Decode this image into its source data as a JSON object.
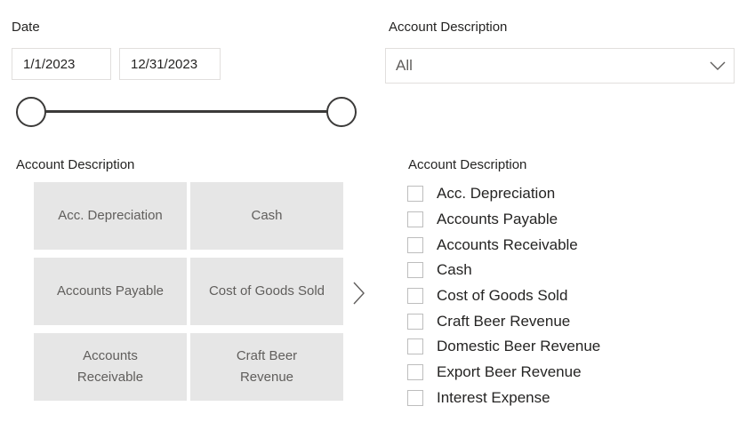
{
  "date_slicer": {
    "label": "Date",
    "start": "1/1/2023",
    "end": "12/31/2023"
  },
  "dropdown_slicer": {
    "label": "Account Description",
    "selected": "All",
    "chevron_icon": "chevron-down-icon"
  },
  "tile_slicer": {
    "label": "Account Description",
    "tiles": [
      "Acc. Depreciation",
      "Cash",
      "Accounts Payable",
      "Cost of Goods Sold",
      "Accounts Receivable",
      "Craft Beer Revenue"
    ],
    "next_icon": "chevron-right-icon"
  },
  "list_slicer": {
    "label": "Account Description",
    "items": [
      {
        "label": "Acc. Depreciation",
        "checked": false
      },
      {
        "label": "Accounts Payable",
        "checked": false
      },
      {
        "label": "Accounts Receivable",
        "checked": false
      },
      {
        "label": "Cash",
        "checked": false
      },
      {
        "label": "Cost of Goods Sold",
        "checked": false
      },
      {
        "label": "Craft Beer Revenue",
        "checked": false
      },
      {
        "label": "Domestic Beer Revenue",
        "checked": false
      },
      {
        "label": "Export Beer Revenue",
        "checked": false
      },
      {
        "label": "Interest Expense",
        "checked": false
      }
    ]
  },
  "colors": {
    "tile_bg": "#e6e6e6",
    "border": "#e1dfdd",
    "slider": "#3b3a39",
    "text": "#252423",
    "muted_text": "#605e5c"
  }
}
